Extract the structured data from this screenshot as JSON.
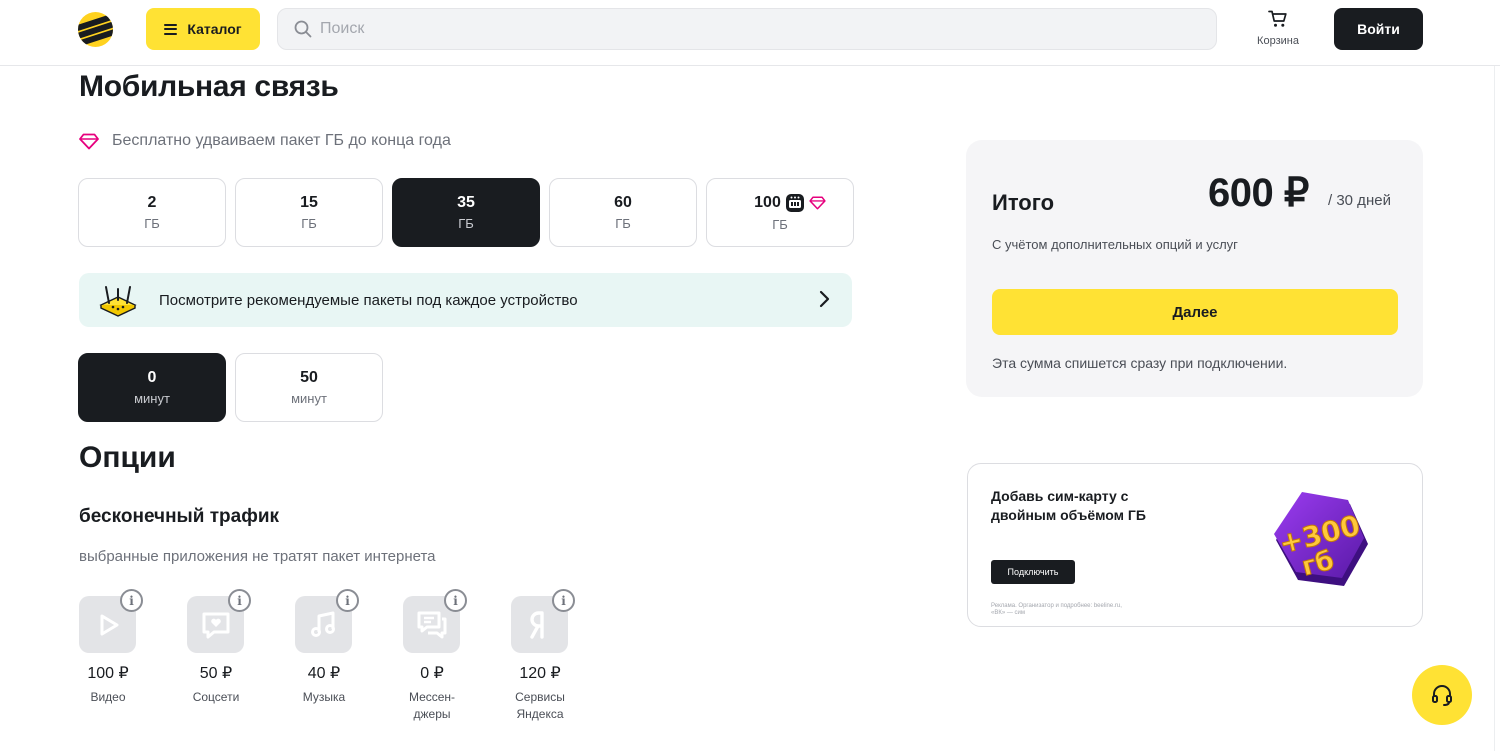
{
  "header": {
    "catalog_label": "Каталог",
    "search_placeholder": "Поиск",
    "cart_label": "Корзина",
    "login_label": "Войти"
  },
  "page": {
    "title": "Мобильная связь",
    "promo_text": "Бесплатно удваиваем пакет ГБ до конца года"
  },
  "gb_packages": [
    {
      "value": "2",
      "unit": "ГБ",
      "selected": false
    },
    {
      "value": "15",
      "unit": "ГБ",
      "selected": false
    },
    {
      "value": "35",
      "unit": "ГБ",
      "selected": true
    },
    {
      "value": "60",
      "unit": "ГБ",
      "selected": false
    },
    {
      "value": "100",
      "unit": "ГБ",
      "selected": false,
      "icons": [
        "router-icon",
        "diamond-icon"
      ]
    }
  ],
  "device_banner": {
    "text": "Посмотрите рекомендуемые пакеты под каждое устройство"
  },
  "minute_packages": [
    {
      "value": "0",
      "unit": "минут",
      "selected": true
    },
    {
      "value": "50",
      "unit": "минут",
      "selected": false
    }
  ],
  "options": {
    "title": "Опции",
    "subtitle": "бесконечный трафик",
    "description": "выбранные приложения не тратят пакет интернета",
    "apps": [
      {
        "price": "100 ₽",
        "label": "Видео",
        "icon": "play-icon"
      },
      {
        "price": "50 ₽",
        "label": "Соцсети",
        "icon": "chat-heart-icon"
      },
      {
        "price": "40 ₽",
        "label": "Музыка",
        "icon": "music-note-icon"
      },
      {
        "price": "0 ₽",
        "label": "Мессен-\nджеры",
        "icon": "messages-icon"
      },
      {
        "price": "120 ₽",
        "label": "Сервисы\nЯндекса",
        "icon": "yandex-icon"
      }
    ]
  },
  "summary": {
    "label": "Итого",
    "price": "600 ₽",
    "period": "/ 30 дней",
    "note": "С учётом дополнительных опций и услуг",
    "next_label": "Далее",
    "footer": "Эта сумма спишется сразу при подключении."
  },
  "sim_promo": {
    "title": "Добавь сим-карту с двойным объёмом ГБ",
    "button_label": "Подключить",
    "legal": "Реклама. Организатор и подробнее: beeline.ru, «ВК» — сим",
    "badge_text": "+300 гб"
  },
  "colors": {
    "brand_yellow": "#ffe234",
    "dark": "#191c20",
    "accent_pink": "#e6007e",
    "banner_mint": "#e8f6f4",
    "badge_purple": "#7a2bd6"
  }
}
